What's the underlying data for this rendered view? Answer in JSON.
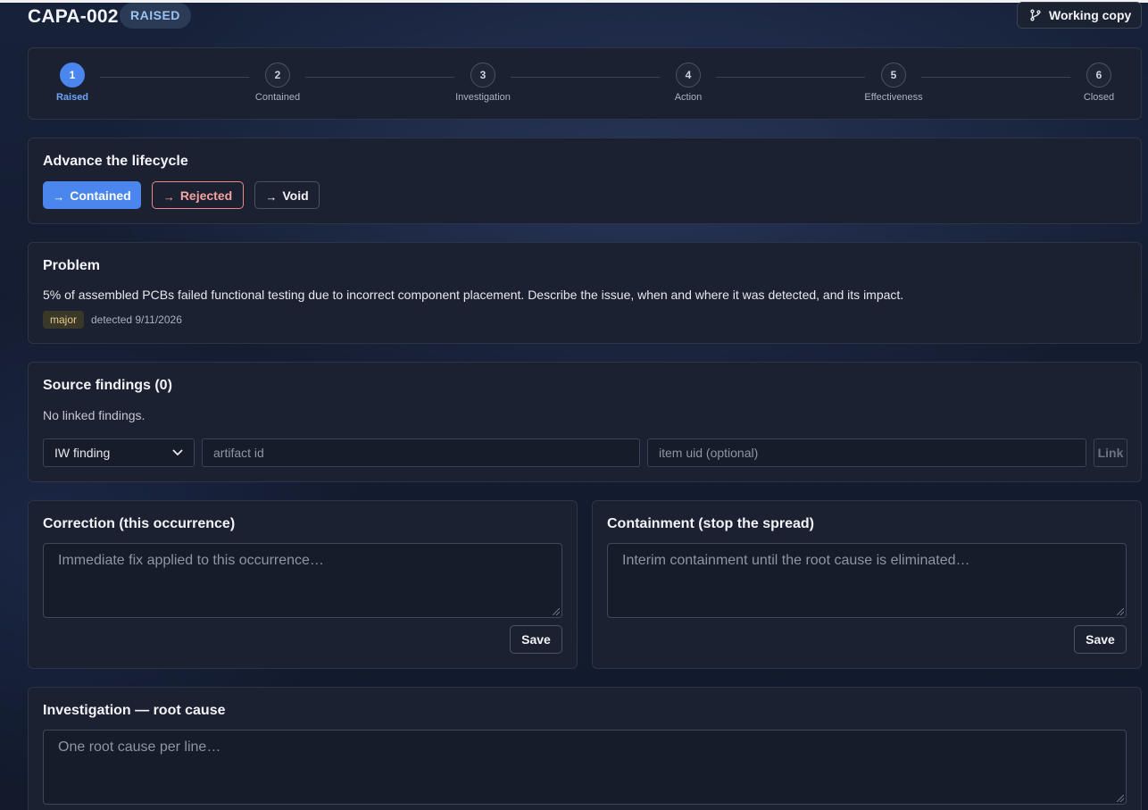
{
  "header": {
    "title": "CAPA-002",
    "status": "RAISED",
    "working_copy_label": "Working copy"
  },
  "stepper": {
    "steps": [
      {
        "number": "1",
        "label": "Raised",
        "active": true
      },
      {
        "number": "2",
        "label": "Contained",
        "active": false
      },
      {
        "number": "3",
        "label": "Investigation",
        "active": false
      },
      {
        "number": "4",
        "label": "Action",
        "active": false
      },
      {
        "number": "5",
        "label": "Effectiveness",
        "active": false
      },
      {
        "number": "6",
        "label": "Closed",
        "active": false
      }
    ]
  },
  "advance": {
    "title": "Advance the lifecycle",
    "arrow": "→",
    "contained_label": "Contained",
    "rejected_label": "Rejected",
    "void_label": "Void"
  },
  "problem": {
    "title": "Problem",
    "description": "5% of assembled PCBs failed functional testing due to incorrect component placement. Describe the issue, when and where it was detected, and its impact.",
    "severity": "major",
    "detected": "detected 9/11/2026"
  },
  "findings": {
    "title": "Source findings (0)",
    "empty_text": "No linked findings.",
    "type_select": "IW finding",
    "artifact_placeholder": "artifact id",
    "item_placeholder": "item uid (optional)",
    "link_label": "Link"
  },
  "correction": {
    "title": "Correction (this occurrence)",
    "placeholder": "Immediate fix applied to this occurrence…",
    "save_label": "Save"
  },
  "containment": {
    "title": "Containment (stop the spread)",
    "placeholder": "Interim containment until the root cause is eliminated…",
    "save_label": "Save"
  },
  "investigation": {
    "title": "Investigation — root cause",
    "placeholder": "One root cause per line…"
  },
  "colors": {
    "accent": "#4a86ee",
    "danger": "#e88a8a",
    "card": "#1b2130",
    "badge_text": "#9cc2f5"
  }
}
